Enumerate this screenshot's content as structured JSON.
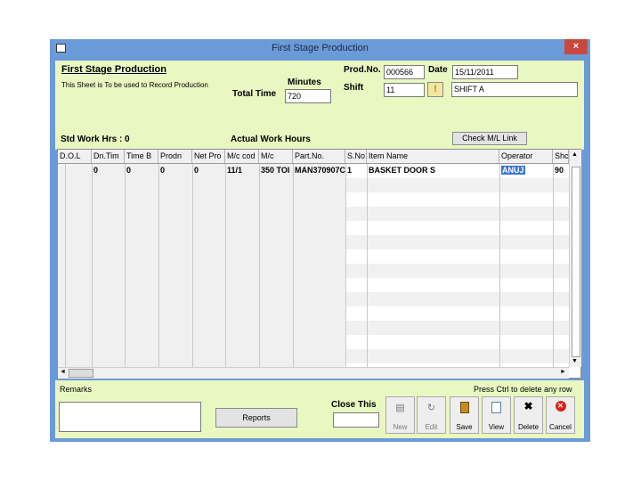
{
  "window": {
    "title": "First Stage Production",
    "close_glyph": "×"
  },
  "form": {
    "heading": "First Stage Production",
    "description": "This Sheet is To be used to Record Production",
    "minutes_label": "Minutes",
    "total_time_label": "Total Time",
    "total_time_value": "720",
    "prod_no_label": "Prod.No.",
    "prod_no_value": "000566",
    "date_label": "Date",
    "date_value": "15/11/2011",
    "shift_label": "Shift",
    "shift_code": "11",
    "shift_name": "SHIFT A",
    "std_work_hrs": "Std Work Hrs : 0",
    "actual_work_hours": "Actual Work Hours",
    "check_link_button": "Check M/L Link"
  },
  "grid": {
    "columns": [
      "D.O.L",
      "Dn.Tim",
      "Time B",
      "Prodn",
      "Net Pro",
      "M/c cod",
      "M/c",
      "Part.No.",
      "S.No",
      "Item Name",
      "Operator",
      "Shc"
    ],
    "rows": [
      [
        "",
        "0",
        "0",
        "0",
        "0",
        "11/1",
        "350 TOI",
        "MAN370907C",
        "1",
        "BASKET DOOR S",
        "ANUJ",
        "90"
      ]
    ]
  },
  "footer": {
    "remarks_label": "Remarks",
    "hint": "Press Ctrl to delete any row",
    "reports_button": "Reports",
    "close_this_label": "Close This",
    "toolbar": [
      {
        "label": "New",
        "icon": "new-icon"
      },
      {
        "label": "Edit",
        "icon": "edit-icon"
      },
      {
        "label": "Save",
        "icon": "save-icon"
      },
      {
        "label": "View",
        "icon": "view-icon"
      },
      {
        "label": "Delete",
        "icon": "delete-icon"
      },
      {
        "label": "Cancel",
        "icon": "cancel-icon"
      }
    ]
  },
  "colors": {
    "form_bg": "#e9f7c1",
    "title_bar": "#6b9ad9",
    "close_red": "#c9483e",
    "selection": "#3875d7"
  }
}
